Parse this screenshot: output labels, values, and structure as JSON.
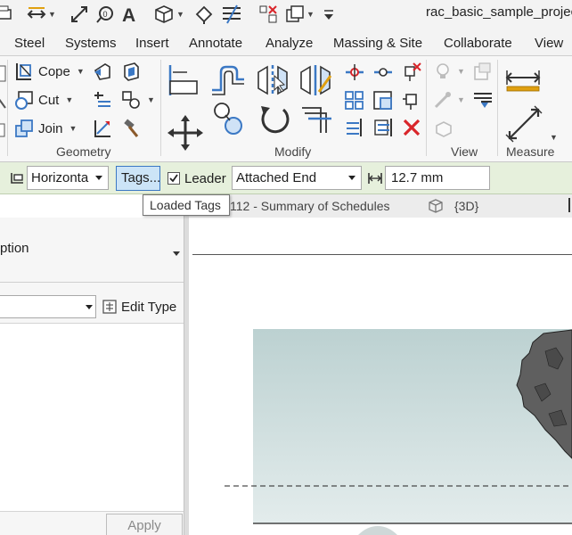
{
  "app_title": "rac_basic_sample_project",
  "tabs": [
    "Steel",
    "Systems",
    "Insert",
    "Annotate",
    "Analyze",
    "Massing & Site",
    "Collaborate",
    "View"
  ],
  "geometry": {
    "title": "Geometry",
    "cope_label": "Cope",
    "cut_label": "Cut",
    "join_label": "Join"
  },
  "modify": {
    "title": "Modify"
  },
  "view_panel": {
    "title": "View"
  },
  "measure": {
    "title": "Measure"
  },
  "options": {
    "orientation": "Horizonta",
    "tags_label": "Tags...",
    "leader_label": "Leader",
    "leader_checked": true,
    "end_value": "Attached End",
    "length_value": "12.7 mm"
  },
  "tooltip": "Loaded Tags",
  "view_tabs": {
    "schedule": "112 - Summary of Schedules",
    "threed": "{3D}"
  },
  "properties": {
    "description": "ption",
    "edit_type_label": "Edit Type",
    "apply_label": "Apply"
  },
  "colors": {
    "options_bg": "#e6f0dc",
    "accent_blue": "#3b78c4",
    "delete_red": "#d9252a",
    "selection": "#cce4f7"
  }
}
